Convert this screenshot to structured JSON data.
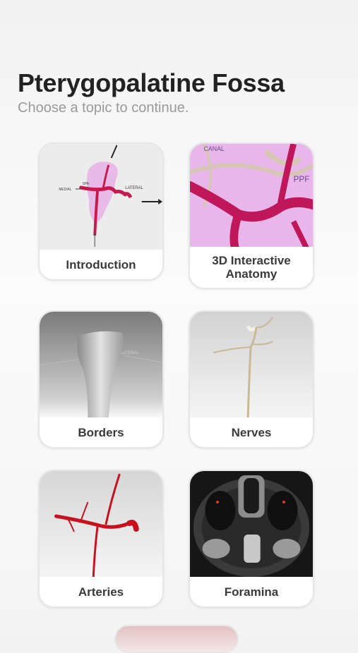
{
  "header": {
    "title": "Pterygopalatine Fossa",
    "subtitle": "Choose a topic to continue."
  },
  "topics": [
    {
      "label": "Introduction",
      "thumb_icon": "fossa-diagram-icon",
      "diagram": {
        "lbl1": "MEDIAL",
        "lbl2": "LATERAL",
        "lbl3": "SPA"
      }
    },
    {
      "label": "3D Interactive Anatomy",
      "thumb_icon": "3d-anatomy-icon",
      "overlay": {
        "canal": "CANAL",
        "ppf": "PPF"
      }
    },
    {
      "label": "Borders",
      "thumb_icon": "fossa-borders-icon",
      "overlay": {
        "lateral": "LATERAL"
      }
    },
    {
      "label": "Nerves",
      "thumb_icon": "nerve-model-icon"
    },
    {
      "label": "Arteries",
      "thumb_icon": "artery-model-icon"
    },
    {
      "label": "Foramina",
      "thumb_icon": "ct-scan-icon"
    }
  ],
  "colors": {
    "artery": "#c8194f",
    "fossa_pink": "#e6a6e6",
    "label_text": "#3a3a3a",
    "title_text": "#222222",
    "subtitle_text": "#9a9a9a"
  }
}
